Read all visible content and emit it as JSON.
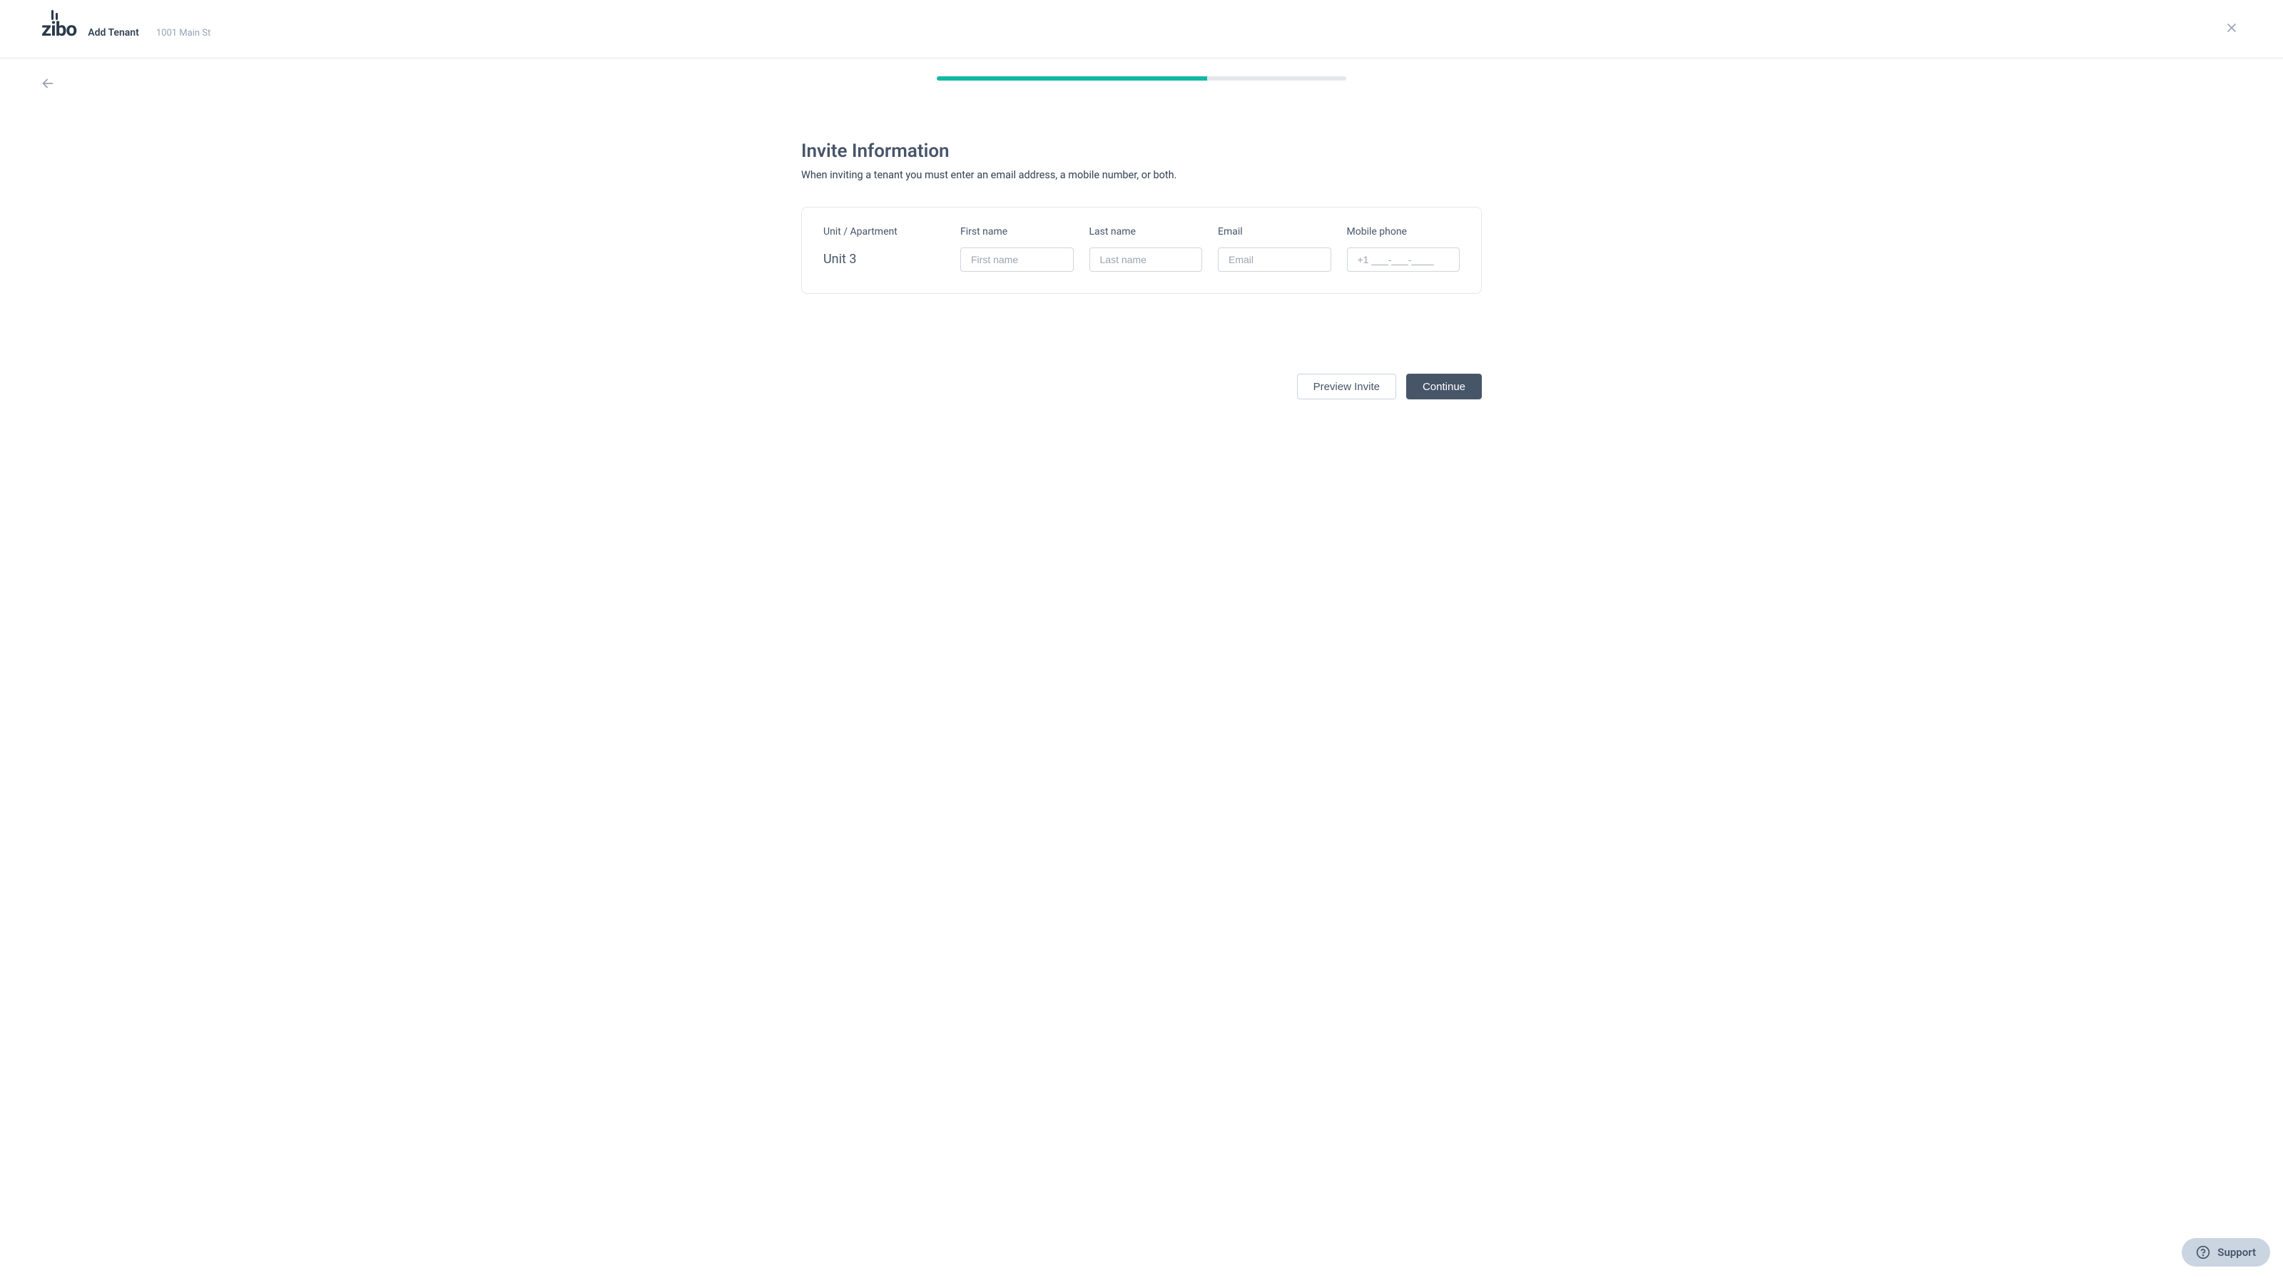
{
  "header": {
    "logo_text": "zibo",
    "flow_title": "Add Tenant",
    "address": "1001 Main St"
  },
  "progress": {
    "percent": 66
  },
  "page": {
    "title": "Invite Information",
    "subtitle": "When inviting a tenant you must enter an email address, a mobile number, or both."
  },
  "form": {
    "unit_label": "Unit / Apartment",
    "unit_value": "Unit 3",
    "first_name_label": "First name",
    "first_name_placeholder": "First name",
    "first_name_value": "",
    "last_name_label": "Last name",
    "last_name_placeholder": "Last name",
    "last_name_value": "",
    "email_label": "Email",
    "email_placeholder": "Email",
    "email_value": "",
    "phone_label": "Mobile phone",
    "phone_placeholder": "+1 ___-___-____",
    "phone_value": ""
  },
  "actions": {
    "preview_label": "Preview Invite",
    "continue_label": "Continue"
  },
  "support": {
    "label": "Support"
  }
}
